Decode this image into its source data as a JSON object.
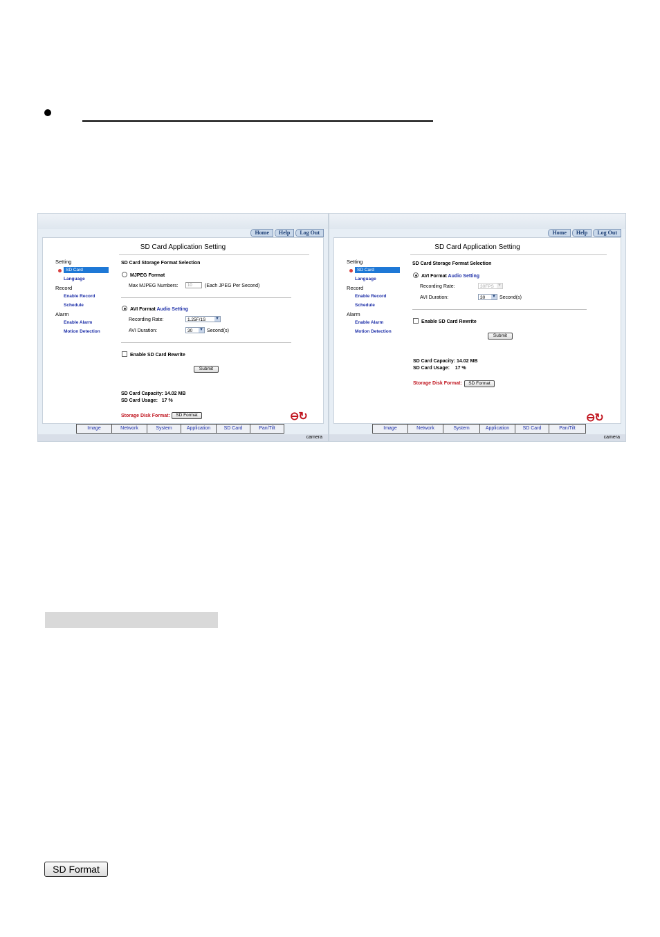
{
  "screens": [
    {
      "nav": [
        "Home",
        "Help",
        "Log Out"
      ],
      "title": "SD Card Application Setting",
      "sidebar": {
        "setting": "Setting",
        "sd_card": "SD Card",
        "language": "Language",
        "record": "Record",
        "enable_record": "Enable Record",
        "schedule": "Schedule",
        "alarm": "Alarm",
        "enable_alarm": "Enable Alarm",
        "motion_detection": "Motion Detection"
      },
      "storage_heading": "SD Card Storage Format Selection",
      "mjpeg_label": "MJPEG Format",
      "max_mjpeg_label": "Max MJPEG Numbers:",
      "max_mjpeg_value": "10",
      "max_mjpeg_hint": "(Each JPEG Per Second)",
      "avi_label": "AVI Format",
      "audio_setting": "Audio Setting",
      "recording_rate_label": "Recording Rate:",
      "recording_rate_value": "1.25F/1S",
      "avi_duration_label": "AVI Duration:",
      "avi_duration_value": "30",
      "seconds_label": "Second(s)",
      "rewrite_label": "Enable SD Card Rewrite",
      "submit": "Submit",
      "capacity_label": "SD Card Capacity:",
      "capacity_value": "14.02 MB",
      "usage_label": "SD Card Usage:",
      "usage_value": "17 %",
      "storage_disk_format": "Storage Disk Format:",
      "sd_format_button": "SD Format",
      "tabs": [
        "Image",
        "Network",
        "System",
        "Application",
        "SD Card",
        "Pan/Tilt"
      ],
      "footer_brand": "camera"
    },
    {
      "nav": [
        "Home",
        "Help",
        "Log Out"
      ],
      "title": "SD Card Application Setting",
      "sidebar": {
        "setting": "Setting",
        "sd_card": "SD Card",
        "language": "Language",
        "record": "Record",
        "enable_record": "Enable Record",
        "schedule": "Schedule",
        "alarm": "Alarm",
        "enable_alarm": "Enable Alarm",
        "motion_detection": "Motion Detection"
      },
      "storage_heading": "SD Card Storage Format Selection",
      "avi_label": "AVI Format",
      "audio_setting": "Audio Setting",
      "recording_rate_label": "Recording Rate:",
      "recording_rate_value": "30FPS",
      "avi_duration_label": "AVI Duration:",
      "avi_duration_value": "30",
      "seconds_label": "Second(s)",
      "rewrite_label": "Enable SD Card Rewrite",
      "submit": "Submit",
      "capacity_label": "SD Card Capacity:",
      "capacity_value": "14.02 MB",
      "usage_label": "SD Card Usage:",
      "usage_value": "17 %",
      "storage_disk_format": "Storage Disk Format:",
      "sd_format_button": "SD Format",
      "tabs": [
        "Image",
        "Network",
        "System",
        "Application",
        "SD Card",
        "Pan/Tilt"
      ],
      "footer_brand": "camera"
    }
  ],
  "page_button": "SD Format"
}
